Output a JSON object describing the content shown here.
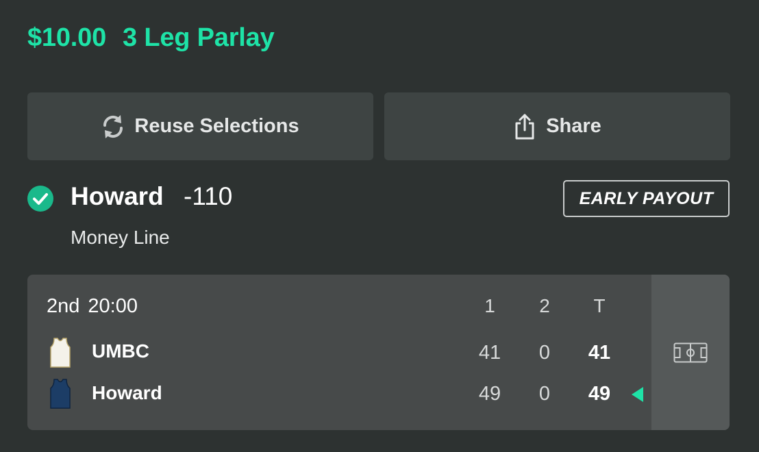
{
  "header": {
    "stake": "$10.00",
    "bet_type": "3 Leg Parlay"
  },
  "actions": {
    "reuse_label": "Reuse Selections",
    "share_label": "Share"
  },
  "selection": {
    "team": "Howard",
    "odds": "-110",
    "market": "Money Line",
    "badge": "EARLY PAYOUT",
    "status": "won"
  },
  "scoreboard": {
    "period": "2nd",
    "clock": "20:00",
    "columns": [
      "1",
      "2",
      "T"
    ],
    "teams": [
      {
        "name": "UMBC",
        "jersey_color": "#f4f2ea",
        "scores": [
          "41",
          "0"
        ],
        "total": "41"
      },
      {
        "name": "Howard",
        "jersey_color": "#1c3d66",
        "scores": [
          "49",
          "0"
        ],
        "total": "49",
        "leading": true
      }
    ]
  },
  "colors": {
    "accent": "#1ee3a7",
    "background": "#2d3231",
    "card": "#474a4a"
  },
  "icons": {
    "reuse": "refresh-icon",
    "share": "share-icon",
    "check": "check-circle-icon",
    "court": "basketball-court-icon"
  }
}
